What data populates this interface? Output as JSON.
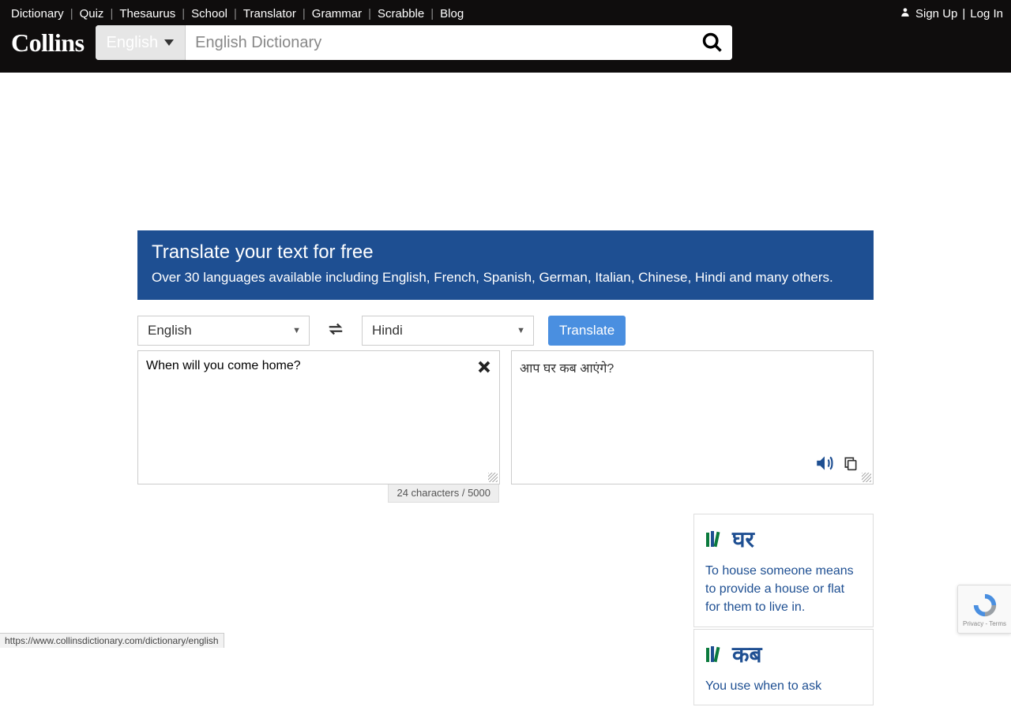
{
  "topnav": {
    "links": [
      "Dictionary",
      "Quiz",
      "Thesaurus",
      "School",
      "Translator",
      "Grammar",
      "Scrabble",
      "Blog"
    ],
    "signup": "Sign Up",
    "login": "Log In"
  },
  "header": {
    "logo": "Collins",
    "language_selector": "English",
    "search_placeholder": "English Dictionary"
  },
  "hero": {
    "title": "Translate your text for free",
    "subtitle": "Over 30 languages available including English, French, Spanish, German, Italian, Chinese, Hindi and many others."
  },
  "translator": {
    "source_lang": "English",
    "target_lang": "Hindi",
    "translate_label": "Translate",
    "input_text": "When will you come home?",
    "output_text": "आप घर कब आएंगे?",
    "char_count": "24 characters / 5000"
  },
  "cards": [
    {
      "word": "घर",
      "definition": "To house someone means to provide a house or flat for them to live in."
    },
    {
      "word": "कब",
      "definition": "You use when to ask"
    }
  ],
  "recaptcha": {
    "privacy": "Privacy",
    "terms": "Terms"
  },
  "status_url": "https://www.collinsdictionary.com/dictionary/english"
}
